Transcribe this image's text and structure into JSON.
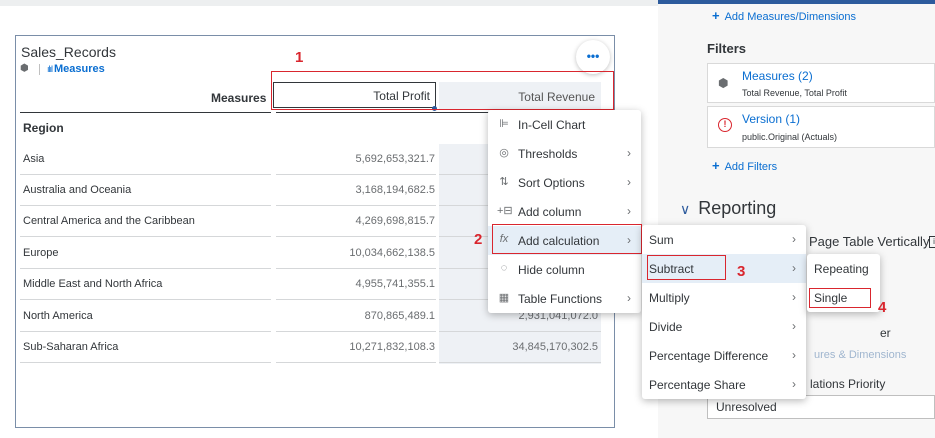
{
  "widget": {
    "title": "Sales_Records",
    "subtitle_link": "Measures",
    "more_icon": "•••",
    "header_measures": "Measures",
    "col_profit": "Total Profit",
    "col_revenue": "Total Revenue",
    "region_header": "Region",
    "rows": [
      {
        "region": "Asia",
        "profit": "5,692,653,321.7",
        "revenue": ""
      },
      {
        "region": "Australia and Oceania",
        "profit": "3,168,194,682.5",
        "revenue": ""
      },
      {
        "region": "Central America and the Caribbean",
        "profit": "4,269,698,815.7",
        "revenue": ""
      },
      {
        "region": "Europe",
        "profit": "10,034,662,138.5",
        "revenue": ""
      },
      {
        "region": "Middle East and North Africa",
        "profit": "4,955,741,355.1",
        "revenue": ""
      },
      {
        "region": "North America",
        "profit": "870,865,489.1",
        "revenue": "2,931,041,072.0"
      },
      {
        "region": "Sub-Saharan Africa",
        "profit": "10,271,832,108.3",
        "revenue": "34,845,170,302.5"
      }
    ]
  },
  "context_menu": {
    "items": [
      {
        "label": "In-Cell Chart",
        "icon": "in-cell-chart-icon",
        "glyph": "⊫",
        "submenu": false
      },
      {
        "label": "Thresholds",
        "icon": "thresholds-icon",
        "glyph": "◎",
        "submenu": true
      },
      {
        "label": "Sort Options",
        "icon": "sort-icon",
        "glyph": "⇅",
        "submenu": true
      },
      {
        "label": "Add column",
        "icon": "add-column-icon",
        "glyph": "+⊟",
        "submenu": true
      },
      {
        "label": "Add calculation",
        "icon": "formula-icon",
        "glyph": "fx",
        "submenu": true
      },
      {
        "label": "Hide column",
        "icon": "hide-icon",
        "glyph": "◌",
        "submenu": false
      },
      {
        "label": "Table Functions",
        "icon": "table-icon",
        "glyph": "▦",
        "submenu": true
      }
    ]
  },
  "calc_menu": {
    "items": [
      "Sum",
      "Subtract",
      "Multiply",
      "Divide",
      "Percentage Difference",
      "Percentage Share"
    ]
  },
  "subtract_menu": {
    "items": [
      "Repeating",
      "Single"
    ]
  },
  "annotations": {
    "n1": "1",
    "n2": "2",
    "n3": "3",
    "n4": "4"
  },
  "right_panel": {
    "add_measures": "Add Measures/Dimensions",
    "filters_label": "Filters",
    "filter1_title": "Measures (2)",
    "filter1_sub": "Total Revenue, Total Profit",
    "filter2_title": "Version (1)",
    "filter2_sub": "public.Original (Actuals)",
    "add_filters": "Add Filters",
    "reporting": "Reporting",
    "page_table": "Page Table Vertically",
    "er_text": "er",
    "faded_link": "ures & Dimensions",
    "lations": "lations Priority",
    "select_value": "Unresolved"
  },
  "colors": {
    "accent": "#0a6ed1",
    "annotation": "#d9262e",
    "header_blue": "#2d5b9d"
  }
}
